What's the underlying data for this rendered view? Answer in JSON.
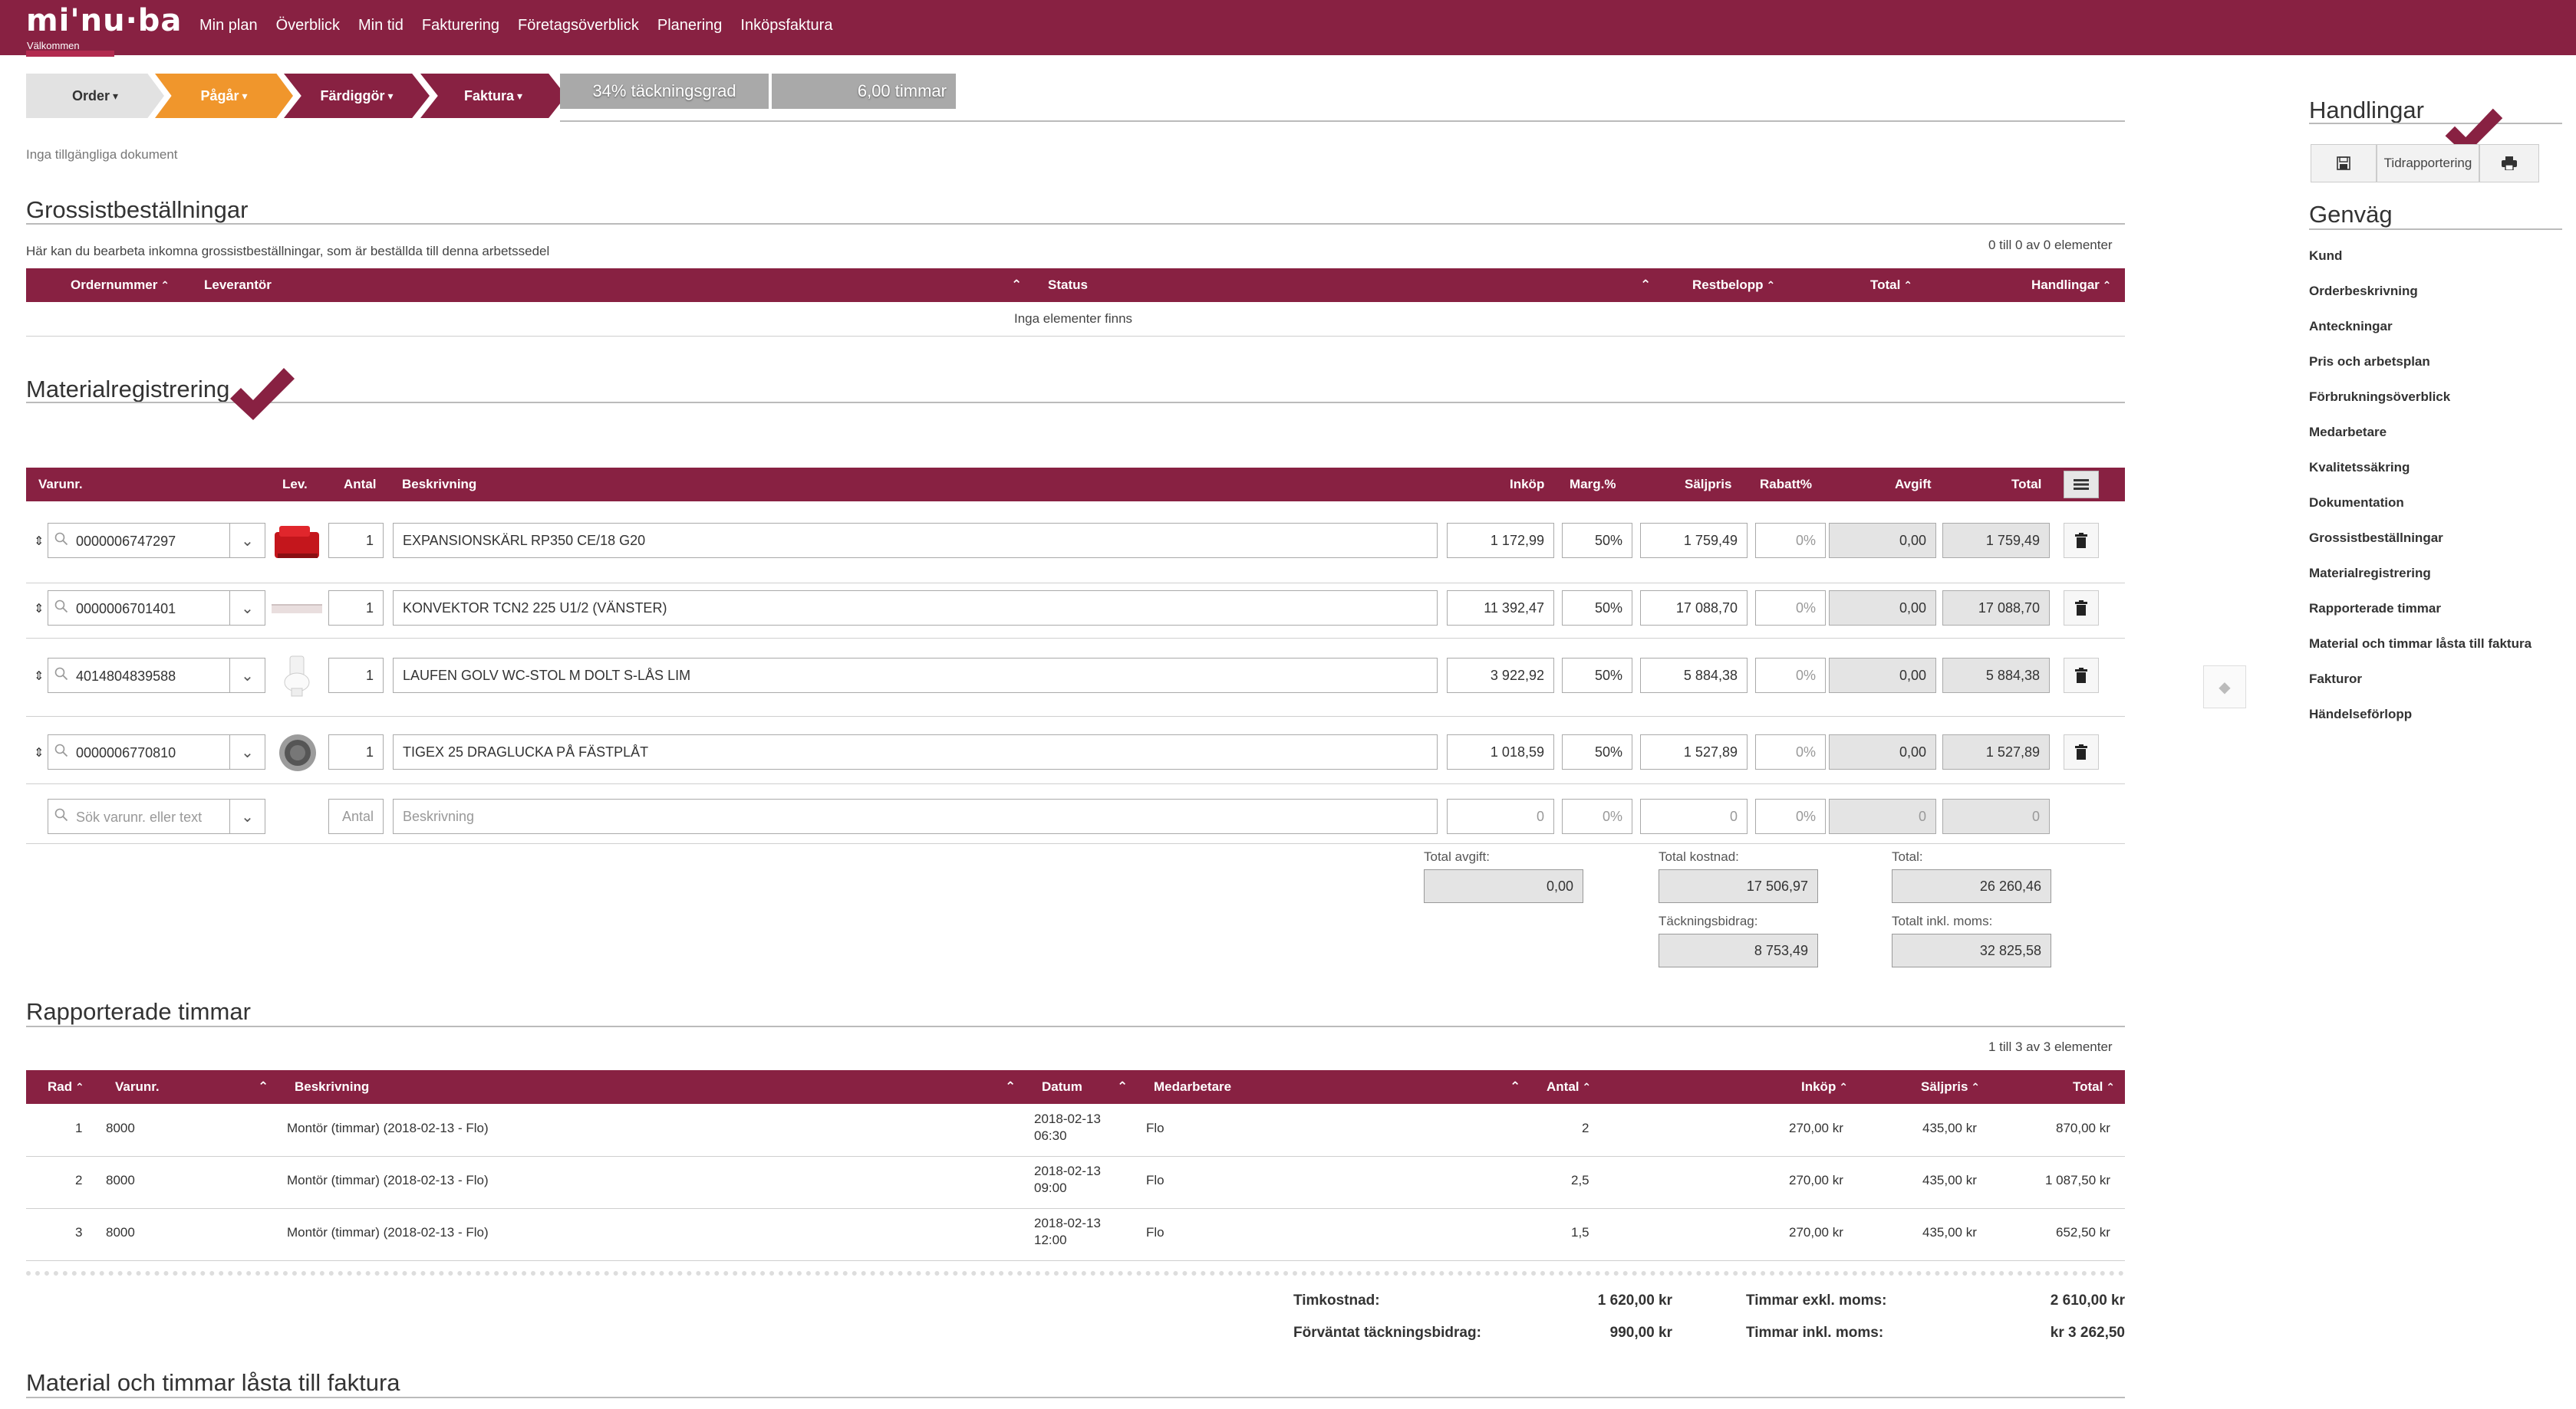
{
  "header": {
    "logo": "mi'nu·ba",
    "welcome": "Välkommen",
    "nav": [
      "Min plan",
      "Överblick",
      "Min tid",
      "Fakturering",
      "Företagsöverblick",
      "Planering",
      "Inköpsfaktura"
    ]
  },
  "steps": {
    "order": "Order",
    "pagar": "Pågår",
    "fardiggor": "Färdiggör",
    "faktura": "Faktura",
    "coverage": "34% täckningsgrad",
    "hours": "6,00 timmar"
  },
  "documents": {
    "empty": "Inga tillgängliga dokument"
  },
  "wholesale": {
    "title": "Grossistbeställningar",
    "description": "Här kan du bearbeta inkomna grossistbeställningar, som är beställda till denna arbetssedel",
    "count": "0 till 0 av 0 elementer",
    "columns": [
      "Ordernummer",
      "Leverantör",
      "Status",
      "Restbelopp",
      "Total",
      "Handlingar"
    ],
    "empty": "Inga elementer finns"
  },
  "material": {
    "title": "Materialregistrering",
    "columns": {
      "varunr": "Varunr.",
      "lev": "Lev.",
      "antal": "Antal",
      "beskrivning": "Beskrivning",
      "inkop": "Inköp",
      "marg": "Marg.%",
      "saljpris": "Säljpris",
      "rabatt": "Rabatt%",
      "avgift": "Avgift",
      "total": "Total"
    },
    "rows": [
      {
        "varunr": "0000006747297",
        "antal": "1",
        "beskrivning": "EXPANSIONSKÄRL RP350 CE/18 G20",
        "inkop": "1 172,99",
        "marg": "50%",
        "saljpris": "1 759,49",
        "rabatt": "0%",
        "avgift": "0,00",
        "total": "1 759,49"
      },
      {
        "varunr": "0000006701401",
        "antal": "1",
        "beskrivning": "KONVEKTOR TCN2 225 U1/2 (VÄNSTER)",
        "inkop": "11 392,47",
        "marg": "50%",
        "saljpris": "17 088,70",
        "rabatt": "0%",
        "avgift": "0,00",
        "total": "17 088,70"
      },
      {
        "varunr": "4014804839588",
        "antal": "1",
        "beskrivning": "LAUFEN GOLV WC-STOL M DOLT S-LÅS LIM",
        "inkop": "3 922,92",
        "marg": "50%",
        "saljpris": "5 884,38",
        "rabatt": "0%",
        "avgift": "0,00",
        "total": "5 884,38"
      },
      {
        "varunr": "0000006770810",
        "antal": "1",
        "beskrivning": "TIGEX 25 DRAGLUCKA PÅ FÄSTPLÅT",
        "inkop": "1 018,59",
        "marg": "50%",
        "saljpris": "1 527,89",
        "rabatt": "0%",
        "avgift": "0,00",
        "total": "1 527,89"
      }
    ],
    "new_row": {
      "search_placeholder": "Sök varunr. eller text",
      "antal_placeholder": "Antal",
      "desc_placeholder": "Beskrivning",
      "inkop": "0",
      "marg": "0%",
      "saljpris": "0",
      "rabatt": "0%",
      "avgift": "0",
      "total": "0"
    },
    "totals": {
      "total_avgift_label": "Total avgift:",
      "total_avgift": "0,00",
      "total_kostnad_label": "Total kostnad:",
      "total_kostnad": "17 506,97",
      "tackningsbidrag_label": "Täckningsbidrag:",
      "tackningsbidrag": "8 753,49",
      "total_label": "Total:",
      "total": "26 260,46",
      "total_moms_label": "Totalt inkl. moms:",
      "total_moms": "32 825,58"
    }
  },
  "hours": {
    "title": "Rapporterade timmar",
    "count": "1 till 3 av 3 elementer",
    "columns": [
      "Rad",
      "Varunr.",
      "Beskrivning",
      "Datum",
      "Medarbetare",
      "Antal",
      "Inköp",
      "Säljpris",
      "Total"
    ],
    "rows": [
      {
        "rad": "1",
        "varunr": "8000",
        "beskrivning": "Montör (timmar) (2018-02-13 - Flo)",
        "datum1": "2018-02-13",
        "datum2": "06:30",
        "medarbetare": "Flo",
        "antal": "2",
        "inkop": "270,00 kr",
        "saljpris": "435,00 kr",
        "total": "870,00 kr"
      },
      {
        "rad": "2",
        "varunr": "8000",
        "beskrivning": "Montör (timmar) (2018-02-13 - Flo)",
        "datum1": "2018-02-13",
        "datum2": "09:00",
        "medarbetare": "Flo",
        "antal": "2,5",
        "inkop": "270,00 kr",
        "saljpris": "435,00 kr",
        "total": "1 087,50 kr"
      },
      {
        "rad": "3",
        "varunr": "8000",
        "beskrivning": "Montör (timmar) (2018-02-13 - Flo)",
        "datum1": "2018-02-13",
        "datum2": "12:00",
        "medarbetare": "Flo",
        "antal": "1,5",
        "inkop": "270,00 kr",
        "saljpris": "435,00 kr",
        "total": "652,50 kr"
      }
    ],
    "summary": {
      "timkostnad_label": "Timkostnad:",
      "timkostnad": "1 620,00 kr",
      "forvantat_label": "Förväntat täckningsbidrag:",
      "forvantat": "990,00 kr",
      "exkl_label": "Timmar exkl. moms:",
      "exkl": "2 610,00 kr",
      "inkl_label": "Timmar inkl. moms:",
      "inkl": "kr 3 262,50"
    }
  },
  "locked": {
    "title": "Material och timmar låsta till faktura"
  },
  "sidebar": {
    "actions_title": "Handlingar",
    "tidrapportering": "Tidrapportering",
    "shortcuts_title": "Genväg",
    "links": [
      "Kund",
      "Orderbeskrivning",
      "Anteckningar",
      "Pris och arbetsplan",
      "Förbrukningsöverblick",
      "Medarbetare",
      "Kvalitetssäkring",
      "Dokumentation",
      "Grossistbeställningar",
      "Materialregistrering",
      "Rapporterade timmar",
      "Material och timmar låsta till faktura",
      "Fakturor",
      "Händelseförlopp"
    ]
  },
  "colors": {
    "brand": "#882142",
    "orange": "#f0962c",
    "grey": "#a9a9a9"
  }
}
